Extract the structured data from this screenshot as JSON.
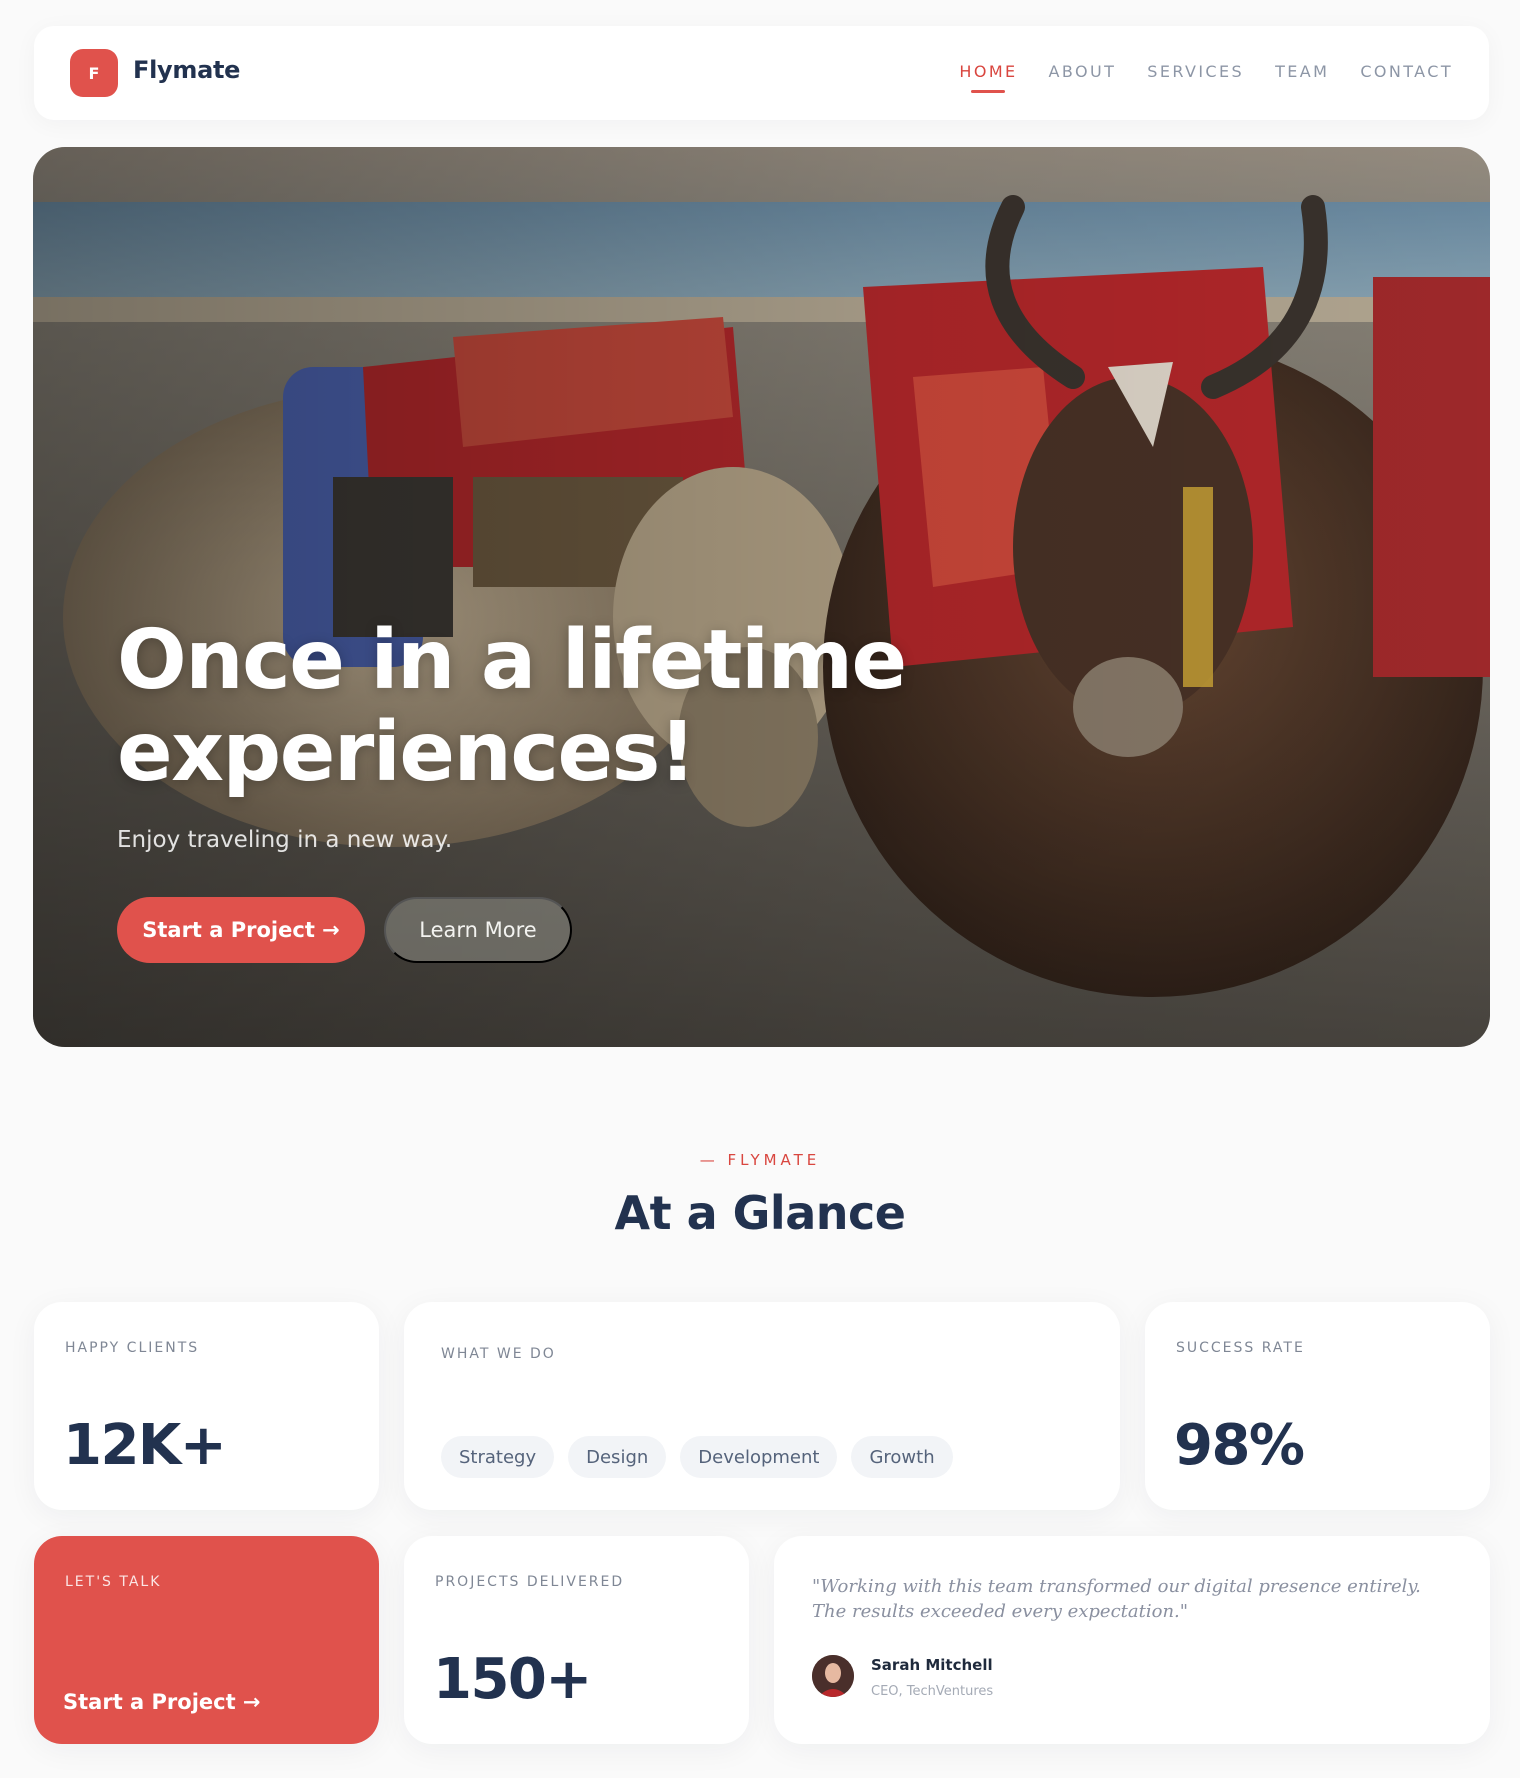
{
  "brand": {
    "logo_letter": "F",
    "name": "Flymate",
    "accent": "#e0524c",
    "navy": "#22324f"
  },
  "nav": {
    "items": [
      {
        "label": "HOME",
        "active": true
      },
      {
        "label": "ABOUT"
      },
      {
        "label": "SERVICES"
      },
      {
        "label": "TEAM"
      },
      {
        "label": "CONTACT"
      }
    ]
  },
  "hero": {
    "title_line1": "Once in a lifetime",
    "title_line2": "experiences!",
    "subtitle": "Enjoy traveling in a new way.",
    "primary_button": "Start a Project →",
    "secondary_button": "Learn More",
    "image_icon": "yak-photo"
  },
  "glance": {
    "eyebrow": "— FLYMATE",
    "title": "At a Glance",
    "happy_clients": {
      "label": "HAPPY CLIENTS",
      "value": "12K+"
    },
    "what_we_do": {
      "label": "WHAT WE DO",
      "tags": [
        "Strategy",
        "Design",
        "Development",
        "Growth"
      ]
    },
    "success_rate": {
      "label": "SUCCESS RATE",
      "value": "98%"
    },
    "lets_talk": {
      "label": "LET'S TALK",
      "link": "Start a Project →"
    },
    "projects_delivered": {
      "label": "PROJECTS DELIVERED",
      "value": "150+"
    },
    "testimonial": {
      "quote": "\"Working with this team transformed our digital presence entirely. The results exceeded every expectation.\"",
      "name": "Sarah Mitchell",
      "role": "CEO, TechVentures"
    }
  }
}
